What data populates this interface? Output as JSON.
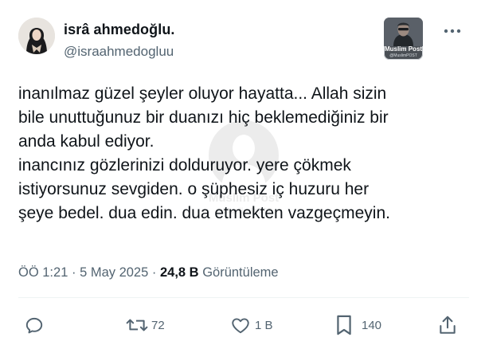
{
  "tweet": {
    "author": {
      "display_name": "isrâ ahmedoğlu.",
      "handle": "@israahmedogluu"
    },
    "affiliate_badge": {
      "title": "Muslim Post",
      "subtitle": "@MuslimPOST"
    },
    "watermark": {
      "title": "Muslim Post",
      "subtitle": "@MuslimPOST"
    },
    "text_lines": [
      "inanılmaz güzel şeyler oluyor hayatta... Allah sizin",
      "bile unuttuğunuz bir duanızı hiç beklemediğiniz bir",
      "anda kabul ediyor.",
      "inancınız gözlerinizi dolduruyor. yere çökmek",
      "istiyorsunuz sevgiden. o şüphesiz iç huzuru her",
      "şeye bedel. dua edin. dua etmekten vazgeçmeyin."
    ],
    "meta": {
      "time": "ÖÖ 1:21",
      "separator": "·",
      "date": "5 May 2025",
      "views_count": "24,8 B",
      "views_label": "Görüntüleme"
    },
    "actions": {
      "reply_icon": "reply-icon",
      "retweet_icon": "retweet-icon",
      "retweet_count": "72",
      "like_icon": "heart-icon",
      "like_count": "1 B",
      "bookmark_icon": "bookmark-icon",
      "bookmark_count": "140",
      "share_icon": "share-icon"
    }
  }
}
